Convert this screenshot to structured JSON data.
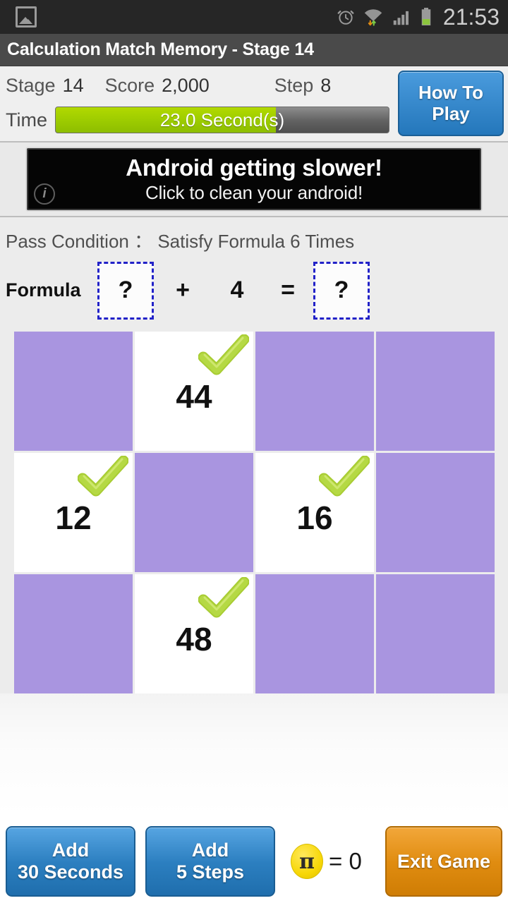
{
  "status_bar": {
    "gallery_icon": "gallery-icon",
    "alarm_icon": "alarm-clock-icon",
    "wifi_icon": "wifi-transfer-icon",
    "signal_icon": "cell-signal-icon",
    "battery_icon": "battery-icon",
    "time": "21:53"
  },
  "title_bar": {
    "title": "Calculation Match Memory - Stage 14"
  },
  "header": {
    "stage_label": "Stage",
    "stage_value": "14",
    "score_label": "Score",
    "score_value": "2,000",
    "step_label": "Step",
    "step_value": "8",
    "time_label": "Time",
    "time_text": "23.0 Second(s)",
    "time_fill_percent": 66,
    "time_fill_color": "#9ccb00",
    "how_to_play_line1": "How To",
    "how_to_play_line2": "Play",
    "how_to_play_color": "#2f86c9"
  },
  "ad": {
    "line1": "Android getting slower!",
    "line2": "Click to clean your android!",
    "info_badge": "i"
  },
  "pass_condition": {
    "text": "Pass Condition ： Satisfy Formula 6 Times"
  },
  "formula": {
    "label": "Formula",
    "left_slot": "?",
    "operator": "+",
    "term": "4",
    "equals": "=",
    "right_slot": "?",
    "slot_border_color": "#2222c8"
  },
  "board": {
    "columns": 4,
    "rows": 3,
    "tile_color": "#a995e0",
    "revealed_color": "#ffffff",
    "check_color": "#b5d944",
    "cells": [
      {
        "revealed": false,
        "value": ""
      },
      {
        "revealed": true,
        "value": "44"
      },
      {
        "revealed": false,
        "value": ""
      },
      {
        "revealed": false,
        "value": ""
      },
      {
        "revealed": true,
        "value": "12"
      },
      {
        "revealed": false,
        "value": ""
      },
      {
        "revealed": true,
        "value": "16"
      },
      {
        "revealed": false,
        "value": ""
      },
      {
        "revealed": false,
        "value": ""
      },
      {
        "revealed": true,
        "value": "48"
      },
      {
        "revealed": false,
        "value": ""
      },
      {
        "revealed": false,
        "value": ""
      }
    ]
  },
  "bottom_bar": {
    "add_seconds_line1": "Add",
    "add_seconds_line2": "30 Seconds",
    "add_steps_line1": "Add",
    "add_steps_line2": "5 Steps",
    "coin_symbol": "π",
    "coin_count": "= 0",
    "exit_label": "Exit Game",
    "exit_color": "#e08c10"
  }
}
